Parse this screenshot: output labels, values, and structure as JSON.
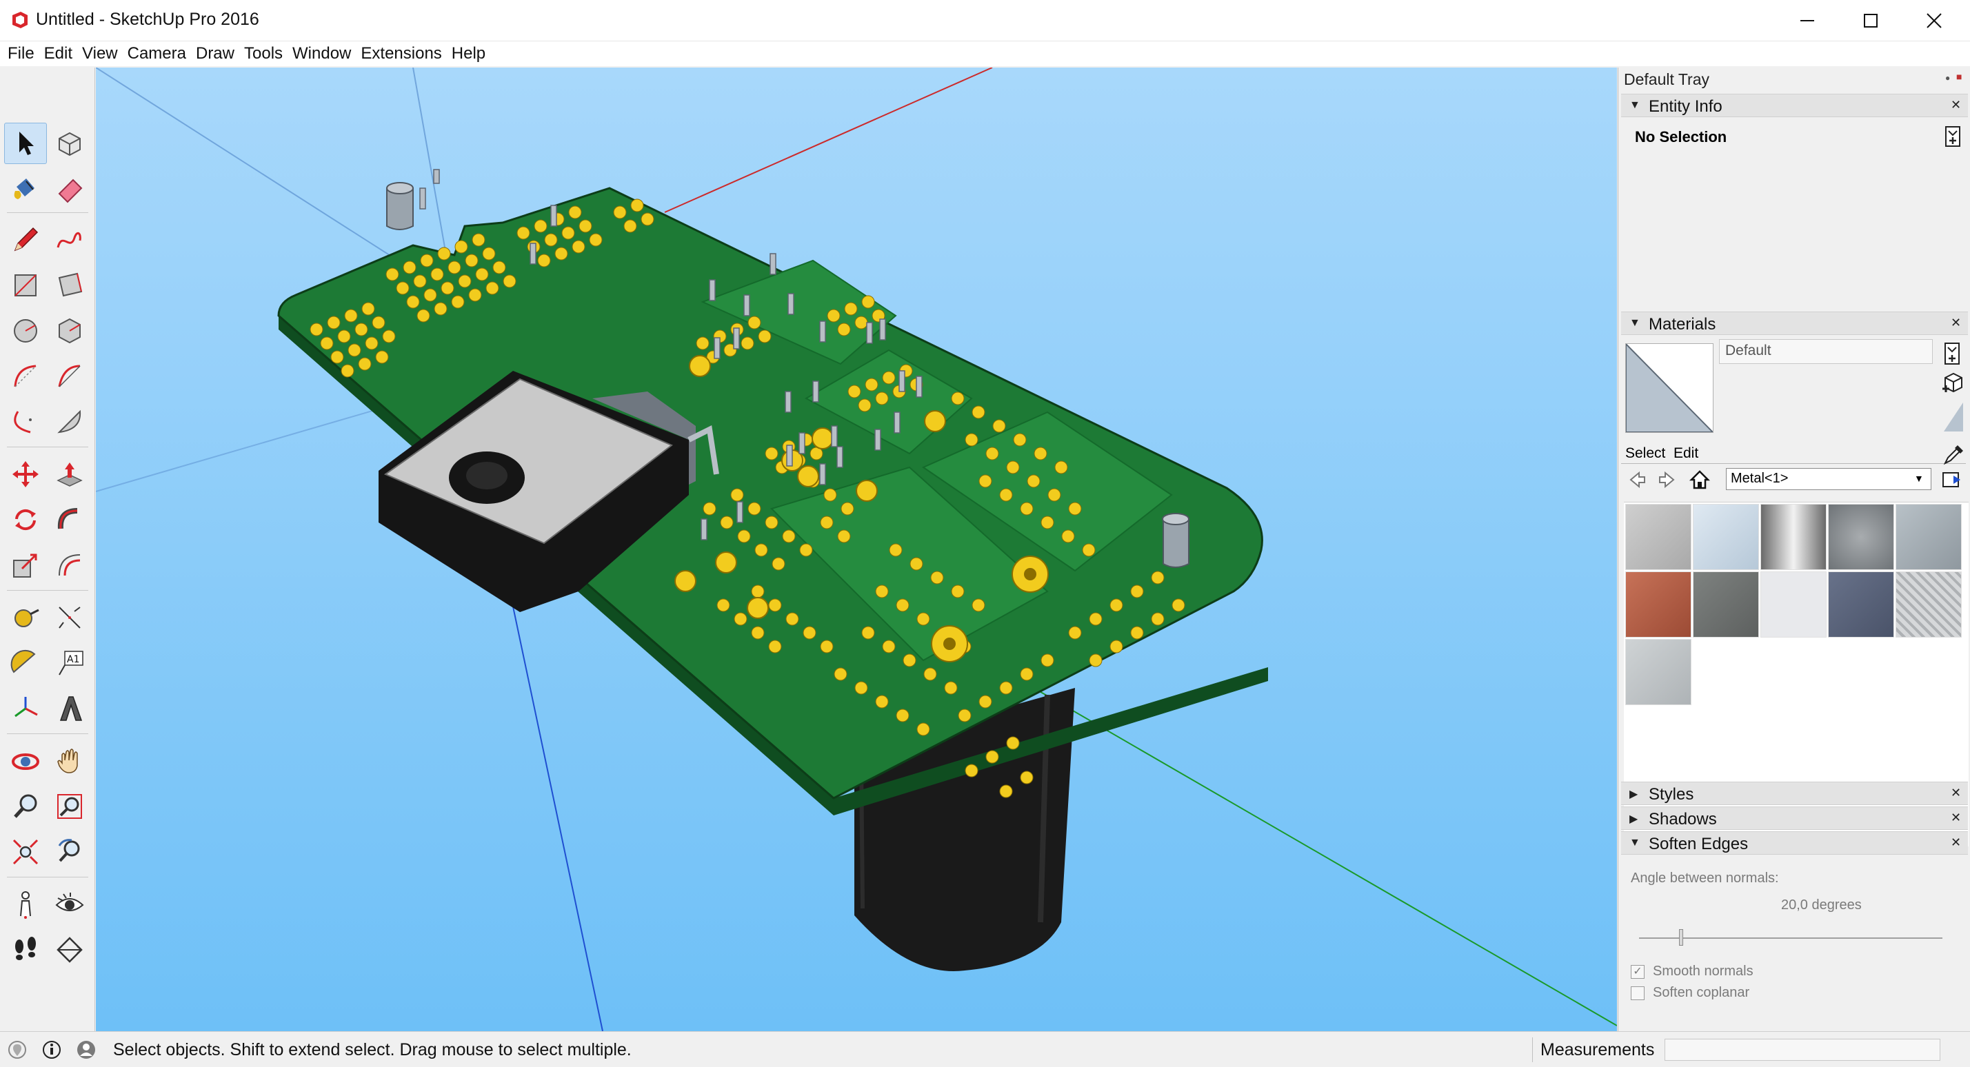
{
  "window": {
    "title": "Untitled - SketchUp Pro 2016",
    "app_icon": "sketchup-icon"
  },
  "menu": [
    "File",
    "Edit",
    "View",
    "Camera",
    "Draw",
    "Tools",
    "Window",
    "Extensions",
    "Help"
  ],
  "toolbar": {
    "tools": [
      "select-tool",
      "make-component-tool",
      "paint-bucket-tool",
      "eraser-tool",
      "line-tool",
      "freehand-tool",
      "rectangle-tool",
      "rotated-rectangle-tool",
      "circle-tool",
      "polygon-tool",
      "arc-tool",
      "two-point-arc-tool",
      "three-point-arc-tool",
      "pie-tool",
      "move-tool",
      "push-pull-tool",
      "rotate-tool",
      "follow-me-tool",
      "scale-tool",
      "offset-tool",
      "tape-measure-tool",
      "dimension-tool",
      "protractor-tool",
      "text-tool",
      "axes-tool",
      "3d-text-tool",
      "orbit-tool",
      "pan-tool",
      "zoom-tool",
      "zoom-window-tool",
      "zoom-extents-tool",
      "previous-view-tool",
      "position-camera-tool",
      "look-around-tool",
      "walk-tool",
      "section-plane-tool"
    ],
    "active_tool": "select-tool"
  },
  "tray": {
    "title": "Default Tray",
    "entity_info": {
      "header": "Entity Info",
      "selection": "No Selection"
    },
    "materials": {
      "header": "Materials",
      "current_material": "Default",
      "tab_select": "Select",
      "tab_edit": "Edit",
      "library": "Metal<1>",
      "swatch_colors": [
        "#bdbdbd",
        "#c9d8e6",
        "#9c9c9c",
        "#8f9396",
        "#a4adb3",
        "#b5614a",
        "#6f7270",
        "#e8e9ec",
        "#5a6479",
        "#c7c9cb",
        "#c2c6c8"
      ]
    },
    "styles": {
      "header": "Styles"
    },
    "shadows": {
      "header": "Shadows"
    },
    "soften_edges": {
      "header": "Soften Edges",
      "angle_label": "Angle between normals:",
      "angle_value": "20,0",
      "angle_unit": "degrees",
      "angle_degrees": 20.0,
      "smooth_normals": {
        "label": "Smooth normals",
        "checked": true
      },
      "soften_coplanar": {
        "label": "Soften coplanar",
        "checked": false
      }
    }
  },
  "statusbar": {
    "message": "Select objects. Shift to extend select. Drag mouse to select multiple.",
    "measurements_label": "Measurements",
    "measurements_value": ""
  },
  "colors": {
    "sky_top": "#a8d8fb",
    "sky_bottom": "#6ec0f7",
    "pcb_green": "#1d7a35",
    "pad_yellow": "#f2cc1e",
    "component_black": "#141414",
    "accent_select": "#cde3f7"
  }
}
